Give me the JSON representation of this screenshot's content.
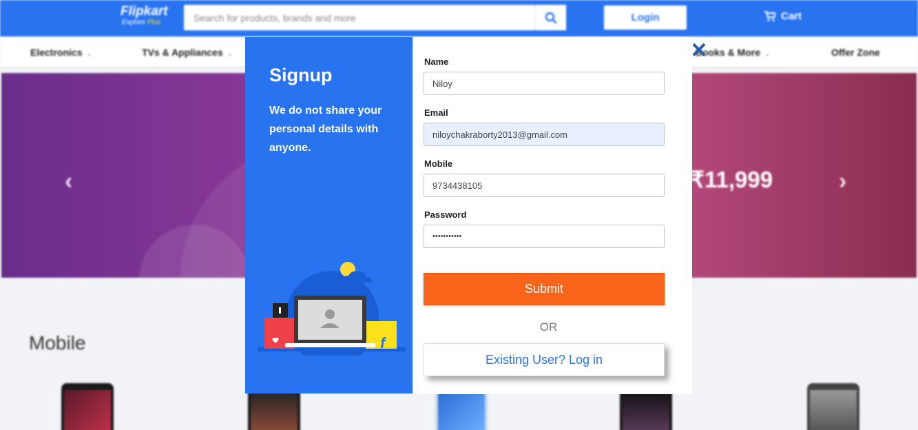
{
  "header": {
    "brand": "Flipkart",
    "tagline_prefix": "Explore",
    "tagline_plus": "Plus",
    "search_placeholder": "Search for products, brands and more",
    "login_label": "Login",
    "cart_label": "Cart"
  },
  "categories": [
    "Electronics",
    "TVs & Appliances",
    "Books & More",
    "Offer Zone"
  ],
  "banner": {
    "price": "₹11,999"
  },
  "section": {
    "title": "Mobile"
  },
  "modal": {
    "title": "Signup",
    "description": "We do not share your personal details with anyone.",
    "fields": {
      "name_label": "Name",
      "name_value": "Niloy",
      "email_label": "Email",
      "email_value": "niloychakraborty2013@gmail.com",
      "mobile_label": "Mobile",
      "mobile_value": "9734438105",
      "password_label": "Password",
      "password_value": "•••••••••••"
    },
    "submit_label": "Submit",
    "or_label": "OR",
    "existing_label": "Existing User? Log in"
  },
  "colors": {
    "primary": "#2874f0",
    "submit": "#fb641b",
    "autofill": "#e8f0fe"
  }
}
